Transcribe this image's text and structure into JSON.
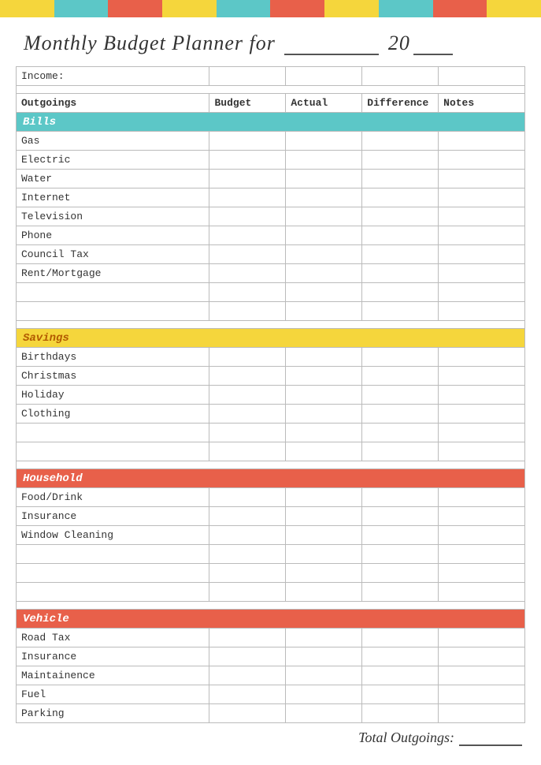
{
  "title": {
    "prefix": "Monthly Budget Planner for",
    "year_prefix": "20",
    "label": "Monthly Budget Planner"
  },
  "header": {
    "income_label": "Income:",
    "col_outgoings": "Outgoings",
    "col_budget": "Budget",
    "col_actual": "Actual",
    "col_diff": "Difference",
    "col_notes": "Notes"
  },
  "categories": {
    "bills": {
      "label": "Bills",
      "color": "#5cc7c7",
      "text_color": "#fff",
      "items": [
        "Gas",
        "Electric",
        "Water",
        "Internet",
        "Television",
        "Phone",
        "Council Tax",
        "Rent/Mortgage",
        "",
        ""
      ]
    },
    "savings": {
      "label": "Savings",
      "color": "#f5d63c",
      "text_color": "#b35a00",
      "items": [
        "Birthdays",
        "Christmas",
        "Holiday",
        "Clothing",
        "",
        ""
      ]
    },
    "household": {
      "label": "Household",
      "color": "#e8604a",
      "text_color": "#fff",
      "items": [
        "Food/Drink",
        "Insurance",
        "Window Cleaning",
        "",
        "",
        ""
      ]
    },
    "vehicle": {
      "label": "Vehicle",
      "color": "#e8604a",
      "text_color": "#fff",
      "items": [
        "Road Tax",
        "Insurance",
        "Maintainence",
        "Fuel",
        "Parking"
      ]
    }
  },
  "total_label": "Total Outgoings:",
  "deco_colors": [
    "#f5d63c",
    "#f5d63c",
    "#5cc7c7",
    "#5cc7c7",
    "#e8604a",
    "#e8604a",
    "#f5d63c",
    "#f5d63c",
    "#5cc7c7",
    "#5cc7c7",
    "#e8604a",
    "#e8604a",
    "#f5d63c",
    "#f5d63c",
    "#5cc7c7",
    "#5cc7c7",
    "#e8604a",
    "#e8604a",
    "#f5d63c",
    "#f5d63c"
  ]
}
